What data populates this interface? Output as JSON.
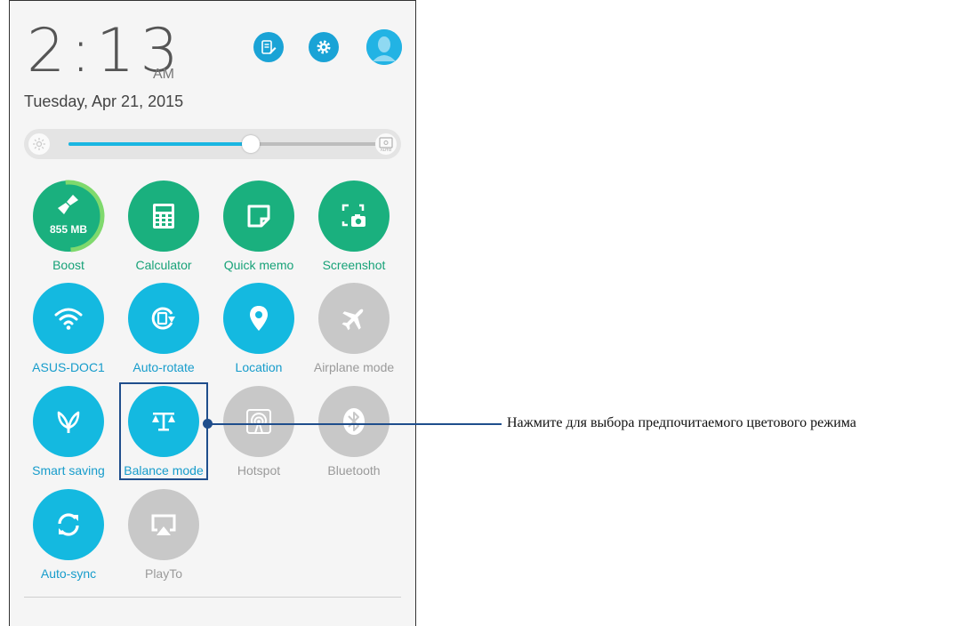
{
  "clock": {
    "time": "2:13",
    "ampm": "AM",
    "date": "Tuesday, Apr 21, 2015"
  },
  "header_buttons": [
    {
      "name": "edit-quick-settings-button",
      "icon": "edit-list-icon"
    },
    {
      "name": "settings-button",
      "icon": "gear-icon"
    },
    {
      "name": "profile-button",
      "icon": "user-avatar-icon"
    }
  ],
  "brightness": {
    "level": 0.59,
    "auto_label": "AUTO"
  },
  "tiles": [
    {
      "id": "boost",
      "label": "Boost",
      "state": "green",
      "icon": "broom-icon",
      "sub": "855 MB"
    },
    {
      "id": "calculator",
      "label": "Calculator",
      "state": "green",
      "icon": "calculator-icon"
    },
    {
      "id": "quick-memo",
      "label": "Quick memo",
      "state": "green",
      "icon": "memo-icon"
    },
    {
      "id": "screenshot",
      "label": "Screenshot",
      "state": "green",
      "icon": "screenshot-icon"
    },
    {
      "id": "wifi",
      "label": "ASUS-DOC1",
      "state": "blue",
      "icon": "wifi-icon"
    },
    {
      "id": "auto-rotate",
      "label": "Auto-rotate",
      "state": "blue",
      "icon": "rotate-icon"
    },
    {
      "id": "location",
      "label": "Location",
      "state": "blue",
      "icon": "location-pin-icon"
    },
    {
      "id": "airplane",
      "label": "Airplane mode",
      "state": "gray",
      "icon": "airplane-icon"
    },
    {
      "id": "smart-saving",
      "label": "Smart saving",
      "state": "blue",
      "icon": "leaf-icon"
    },
    {
      "id": "balance-mode",
      "label": "Balance mode",
      "state": "blue",
      "icon": "balance-scale-icon"
    },
    {
      "id": "hotspot",
      "label": "Hotspot",
      "state": "gray",
      "icon": "hotspot-icon"
    },
    {
      "id": "bluetooth",
      "label": "Bluetooth",
      "state": "gray",
      "icon": "bluetooth-icon"
    },
    {
      "id": "auto-sync",
      "label": "Auto-sync",
      "state": "blue",
      "icon": "sync-icon"
    },
    {
      "id": "playto",
      "label": "PlayTo",
      "state": "gray",
      "icon": "cast-icon"
    }
  ],
  "callout": {
    "text": "Нажмите для выбора предпочитаемого цветового режима"
  },
  "colors": {
    "green": "#1ab07e",
    "blue": "#14b9e0",
    "gray": "#c8c8c8",
    "callout": "#1f4e8c"
  }
}
